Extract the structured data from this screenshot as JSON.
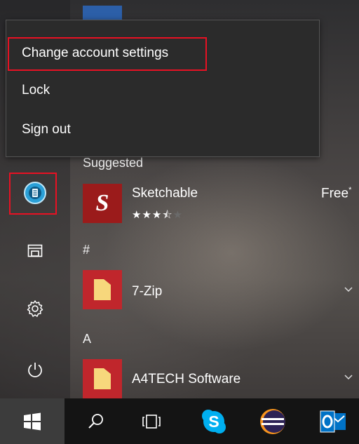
{
  "account_menu": {
    "items": [
      {
        "label": "Change account settings"
      },
      {
        "label": "Lock"
      },
      {
        "label": "Sign out"
      }
    ]
  },
  "app_list": {
    "suggested_header": "Suggested",
    "suggested_app": {
      "name": "Sketchable",
      "price": "Free",
      "price_mark": "*",
      "rating_stars": 3.5,
      "rating_max": 5,
      "icon": "sketchable-logo",
      "icon_letter": "S"
    },
    "groups": [
      {
        "header": "#",
        "apps": [
          {
            "name": "7-Zip",
            "icon": "folder-icon"
          }
        ]
      },
      {
        "header": "A",
        "apps": [
          {
            "name": "A4TECH Software",
            "icon": "folder-icon"
          }
        ]
      }
    ]
  },
  "sidebar": {
    "items": [
      {
        "name": "user-avatar",
        "icon": "user-avatar-icon"
      },
      {
        "name": "file-explorer",
        "icon": "file-explorer-icon"
      },
      {
        "name": "settings",
        "icon": "gear-icon"
      },
      {
        "name": "power",
        "icon": "power-icon"
      }
    ]
  },
  "taskbar": {
    "items": [
      {
        "name": "start",
        "icon": "windows-logo-icon"
      },
      {
        "name": "search",
        "icon": "search-icon"
      },
      {
        "name": "task-view",
        "icon": "task-view-icon"
      },
      {
        "name": "skype",
        "icon": "skype-icon"
      },
      {
        "name": "eclipse",
        "icon": "eclipse-icon"
      },
      {
        "name": "outlook",
        "icon": "outlook-icon"
      }
    ]
  },
  "colors": {
    "highlight_red": "#e81123",
    "menu_bg": "#2b2b2b",
    "tile_red": "#c0262c",
    "sketchable_red": "#9b1b1b",
    "folder_yellow": "#f7d77c",
    "skype_blue": "#00aff0",
    "outlook_blue": "#0072c6",
    "taskbar_bg": "#141414"
  }
}
